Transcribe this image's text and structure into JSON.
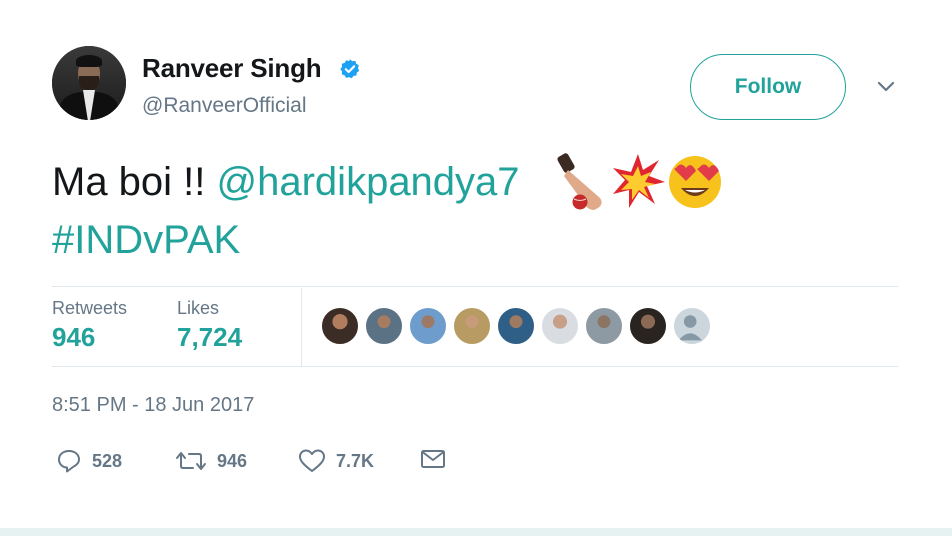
{
  "user": {
    "name": "Ranveer Singh",
    "handle": "@RanveerOfficial",
    "verified_icon": "verified-badge-icon",
    "avatar_icon": "profile-avatar"
  },
  "follow_button": {
    "label": "Follow"
  },
  "tweet": {
    "text_prefix": "Ma boi !! ",
    "mention": "@hardikpandya7",
    "emojis": [
      "cricket-bat-ball-emoji",
      "collision-emoji",
      "heart-eyes-emoji"
    ],
    "hashtag": "#INDvPAK"
  },
  "stats": {
    "retweets_label": "Retweets",
    "retweets_value": "946",
    "likes_label": "Likes",
    "likes_value": "7,724"
  },
  "likers_count": 9,
  "timestamp": "8:51 PM - 18 Jun 2017",
  "actions": {
    "reply_count": "528",
    "retweet_count": "946",
    "like_count": "7.7K"
  },
  "colors": {
    "accent": "#21a29a",
    "secondary_text": "#657786",
    "primary_text": "#14171a",
    "verified": "#1da1f2",
    "divider": "#e1e8ed"
  }
}
